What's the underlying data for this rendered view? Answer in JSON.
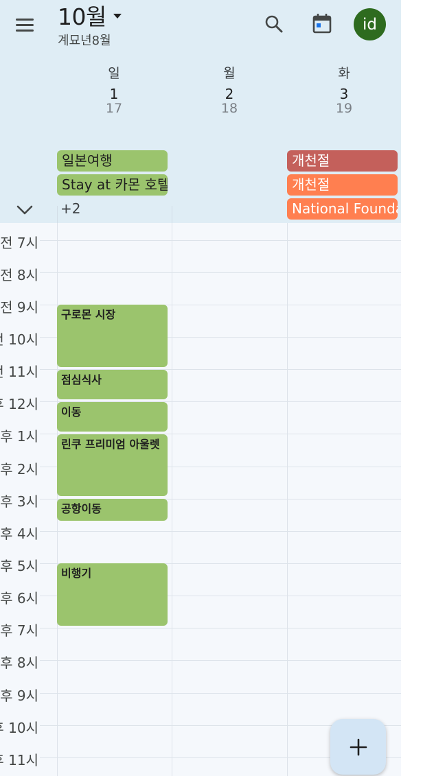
{
  "header": {
    "month_title": "10월",
    "lunar_subtitle": "계묘년8월",
    "avatar_initials": "id",
    "avatar_color": "#2e6b1f"
  },
  "days": [
    {
      "dow": "일",
      "date": "1",
      "lunar": "17"
    },
    {
      "dow": "월",
      "date": "2",
      "lunar": "18"
    },
    {
      "dow": "화",
      "date": "3",
      "lunar": "19"
    }
  ],
  "all_day": {
    "sun": [
      {
        "title": "일본여행",
        "color": "#9bc46d"
      },
      {
        "title": "Stay at 카몬 호텔",
        "color": "#9bc46d"
      }
    ],
    "sun_more": "+2",
    "tue": [
      {
        "title": "개천절",
        "color": "#c4605b"
      },
      {
        "title": "개천절",
        "color": "#ff7f50"
      },
      {
        "title": "National Foundation Day",
        "color": "#ff7f50"
      }
    ]
  },
  "hours": [
    "전 7시",
    "전 8시",
    "전 9시",
    "전 10시",
    "전 11시",
    "후 12시",
    "후 1시",
    "후 2시",
    "후 3시",
    "후 4시",
    "후 5시",
    "후 6시",
    "후 7시",
    "후 8시",
    "후 9시",
    "후 10시",
    "후 11시"
  ],
  "events": [
    {
      "title": "구로몬 시장"
    },
    {
      "title": "점심식사"
    },
    {
      "title": "이동"
    },
    {
      "title": "린쿠 프리미엄 아울렛"
    },
    {
      "title": "공항이동"
    },
    {
      "title": "비행기"
    }
  ],
  "icons": {
    "menu": "menu-icon",
    "search": "search-icon",
    "today": "calendar-today-icon",
    "collapse": "chevron-down-icon",
    "fab": "plus-icon"
  }
}
